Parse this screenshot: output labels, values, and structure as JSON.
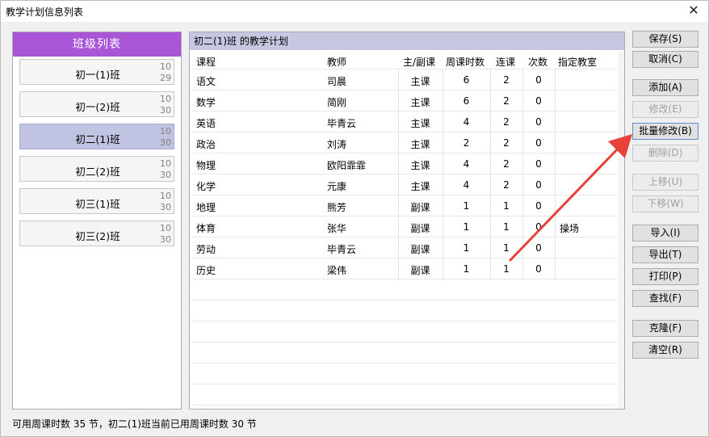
{
  "window": {
    "title": "教学计划信息列表",
    "close_icon": "close-icon"
  },
  "class_list": {
    "header": "班级列表",
    "items": [
      {
        "name": "初一(1)班",
        "n1": "10",
        "n2": "29",
        "selected": false
      },
      {
        "name": "初一(2)班",
        "n1": "10",
        "n2": "30",
        "selected": false
      },
      {
        "name": "初二(1)班",
        "n1": "10",
        "n2": "30",
        "selected": true
      },
      {
        "name": "初二(2)班",
        "n1": "10",
        "n2": "30",
        "selected": false
      },
      {
        "name": "初三(1)班",
        "n1": "10",
        "n2": "30",
        "selected": false
      },
      {
        "name": "初三(2)班",
        "n1": "10",
        "n2": "30",
        "selected": false
      }
    ]
  },
  "plan": {
    "title": "初二(1)班 的教学计划",
    "columns": [
      "课程",
      "教师",
      "主/副课",
      "周课时数",
      "连课",
      "次数",
      "指定教室"
    ],
    "rows": [
      [
        "语文",
        "司晨",
        "主课",
        "6",
        "2",
        "0",
        ""
      ],
      [
        "数学",
        "简刚",
        "主课",
        "6",
        "2",
        "0",
        ""
      ],
      [
        "英语",
        "毕青云",
        "主课",
        "4",
        "2",
        "0",
        ""
      ],
      [
        "政治",
        "刘涛",
        "主课",
        "2",
        "2",
        "0",
        ""
      ],
      [
        "物理",
        "欧阳霏霏",
        "主课",
        "4",
        "2",
        "0",
        ""
      ],
      [
        "化学",
        "元康",
        "主课",
        "4",
        "2",
        "0",
        ""
      ],
      [
        "地理",
        "熊芳",
        "副课",
        "1",
        "1",
        "0",
        ""
      ],
      [
        "体育",
        "张华",
        "副课",
        "1",
        "1",
        "0",
        "操场"
      ],
      [
        "劳动",
        "毕青云",
        "副课",
        "1",
        "1",
        "0",
        ""
      ],
      [
        "历史",
        "梁伟",
        "副课",
        "1",
        "1",
        "0",
        ""
      ]
    ]
  },
  "buttons": {
    "save": "保存(S)",
    "cancel": "取消(C)",
    "add": "添加(A)",
    "edit": "修改(E)",
    "batch_edit": "批量修改(B)",
    "delete": "删除(D)",
    "move_up": "上移(U)",
    "move_down": "下移(W)",
    "import": "导入(I)",
    "export": "导出(T)",
    "print": "打印(P)",
    "find": "查找(F)",
    "clone": "克隆(F)",
    "clear": "清空(R)"
  },
  "status": "可用周课时数 35 节，初二(1)班当前已用周课时数 30 节",
  "colors": {
    "class_header": "#a956d6",
    "selected_class": "#c0c4e2",
    "plan_title": "#c6c8e2",
    "annotation_arrow": "#e8413a"
  }
}
